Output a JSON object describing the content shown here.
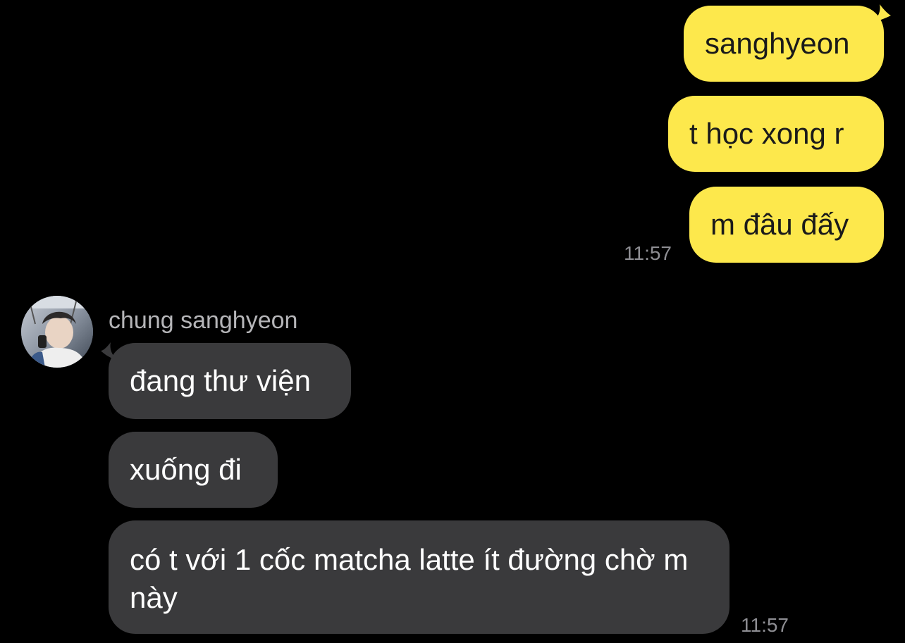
{
  "chat": {
    "outgoing": [
      {
        "text": "sanghyeon"
      },
      {
        "text": "t học xong r"
      },
      {
        "text": "m đâu đấy"
      }
    ],
    "outgoing_time": "11:57",
    "incoming": {
      "sender": "chung sanghyeon",
      "messages": [
        {
          "text": "đang thư viện"
        },
        {
          "text": "xuống đi"
        },
        {
          "text": "có t với 1 cốc matcha latte ít đường chờ m này"
        }
      ],
      "time": "11:57"
    }
  },
  "colors": {
    "background": "#000000",
    "outgoing_bubble": "#fde84c",
    "incoming_bubble": "#3a3a3c",
    "timestamp": "#8e8e93"
  }
}
